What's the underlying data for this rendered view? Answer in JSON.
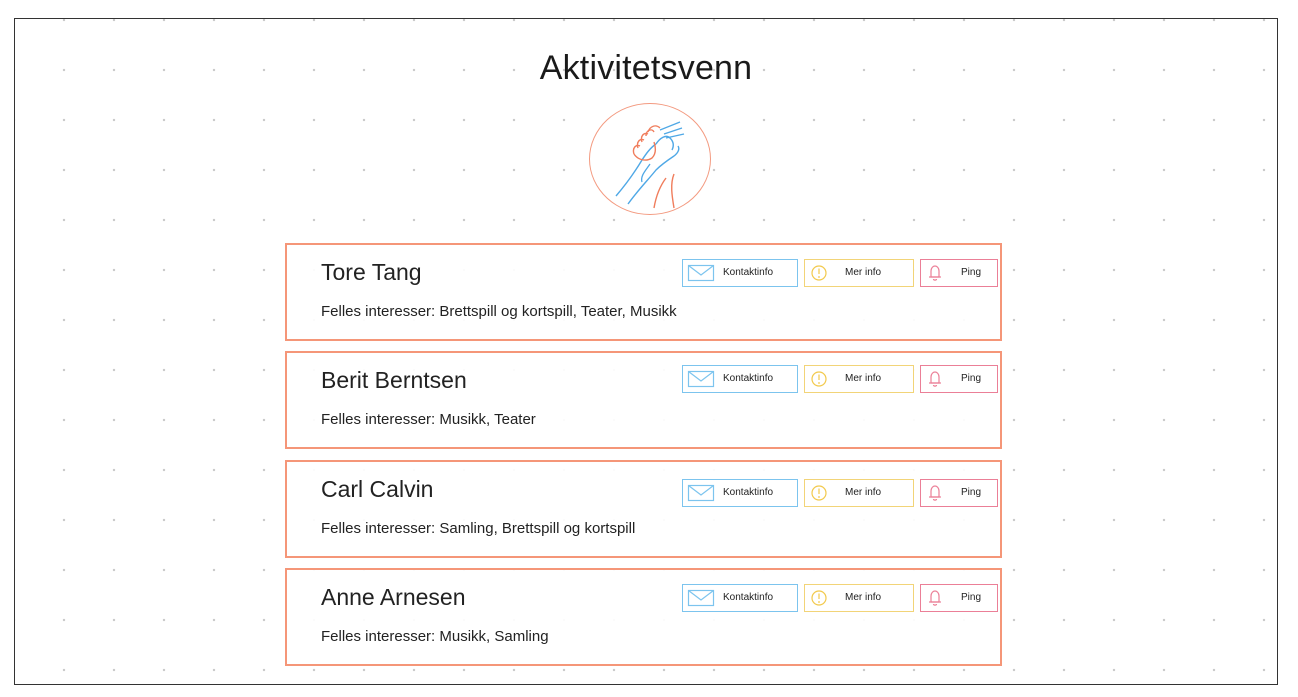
{
  "app": {
    "title": "Aktivitetsvenn",
    "logo_icon": "handshake-icon"
  },
  "colors": {
    "card_border": "#f59678",
    "contact_border": "#7cc4ee",
    "info_border": "#f2d478",
    "ping_border": "#eb7f97"
  },
  "buttons": {
    "contact_label": "Kontaktinfo",
    "info_label": "Mer info",
    "ping_label": "Ping",
    "contact_icon": "envelope-icon",
    "info_icon": "info-icon",
    "ping_icon": "bell-icon"
  },
  "matches": [
    {
      "name": "Tore Tang",
      "interests": "Felles interesser: Brettspill og kortspill, Teater, Musikk"
    },
    {
      "name": "Berit Berntsen",
      "interests": "Felles interesser: Musikk, Teater"
    },
    {
      "name": "Carl Calvin",
      "interests": "Felles interesser: Samling, Brettspill og kortspill"
    },
    {
      "name": "Anne Arnesen",
      "interests": "Felles interesser: Musikk, Samling"
    }
  ]
}
